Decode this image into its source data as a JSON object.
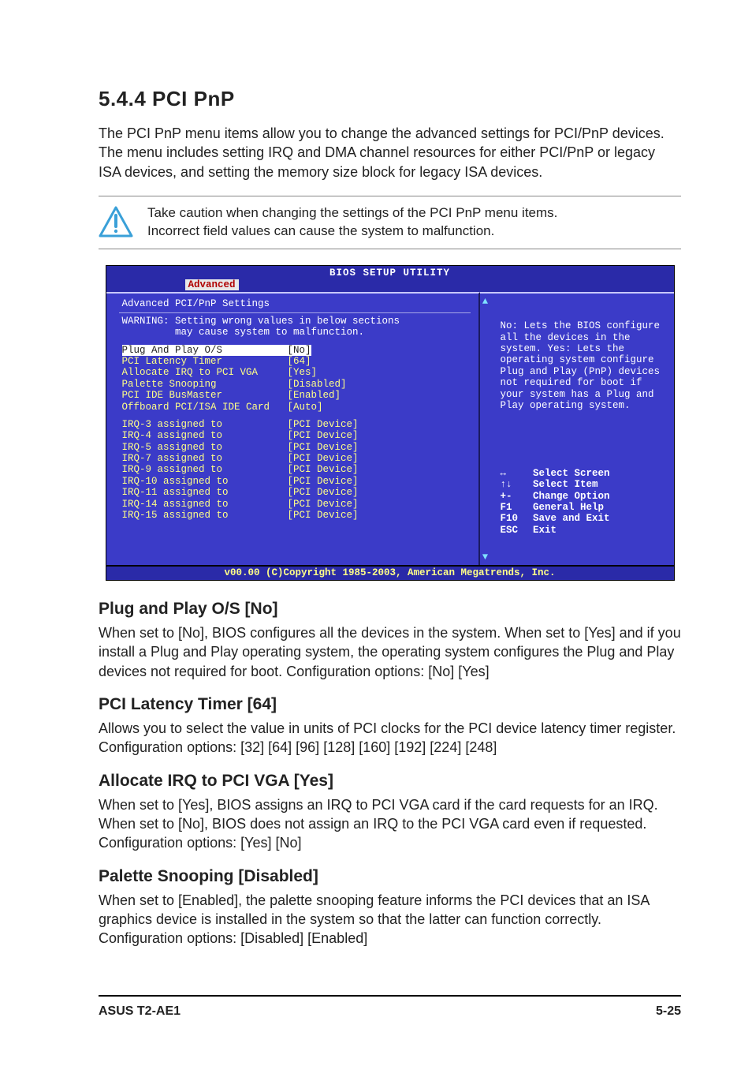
{
  "section": {
    "number_title": "5.4.4   PCI PnP",
    "intro": "The PCI PnP menu items allow you to change the advanced settings for PCI/PnP devices. The menu includes setting IRQ and DMA channel resources for either PCI/PnP or legacy ISA devices, and setting the memory size block for legacy ISA devices."
  },
  "callout": {
    "line1": "Take caution when changing the settings of the PCI PnP menu items.",
    "line2": "Incorrect field values can cause the system to malfunction."
  },
  "bios": {
    "title": "BIOS SETUP UTILITY",
    "tab": "Advanced",
    "left": {
      "heading": "Advanced PCI/PnP Settings",
      "warn1": "WARNING: Setting wrong values in below sections",
      "warn2": "         may cause system to malfunction.",
      "options": [
        {
          "name": "Plug And Play O/S",
          "val": "[No]",
          "sel": true
        },
        {
          "name": "PCI Latency Timer",
          "val": "[64]"
        },
        {
          "name": "Allocate IRQ to PCI VGA",
          "val": "[Yes]"
        },
        {
          "name": "Palette Snooping",
          "val": "[Disabled]"
        },
        {
          "name": "PCI IDE BusMaster",
          "val": "[Enabled]"
        },
        {
          "name": "Offboard PCI/ISA IDE Card",
          "val": "[Auto]"
        }
      ],
      "irqs": [
        {
          "name": "IRQ-3 assigned to",
          "val": "[PCI Device]"
        },
        {
          "name": "IRQ-4 assigned to",
          "val": "[PCI Device]"
        },
        {
          "name": "IRQ-5 assigned to",
          "val": "[PCI Device]"
        },
        {
          "name": "IRQ-7 assigned to",
          "val": "[PCI Device]"
        },
        {
          "name": "IRQ-9 assigned to",
          "val": "[PCI Device]"
        },
        {
          "name": "IRQ-10 assigned to",
          "val": "[PCI Device]"
        },
        {
          "name": "IRQ-11 assigned to",
          "val": "[PCI Device]"
        },
        {
          "name": "IRQ-14 assigned to",
          "val": "[PCI Device]"
        },
        {
          "name": "IRQ-15 assigned to",
          "val": "[PCI Device]"
        }
      ]
    },
    "right": {
      "help": "No: Lets the BIOS configure all the devices in the system. Yes: Lets the operating system configure Plug and Play (PnP) devices not required for boot if your system has a Plug and Play operating system.",
      "keys": [
        {
          "k": "↔",
          "label": "Select Screen"
        },
        {
          "k": "↑↓",
          "label": "Select Item"
        },
        {
          "k": "+-",
          "label": "Change Option"
        },
        {
          "k": "F1",
          "label": "General Help"
        },
        {
          "k": "F10",
          "label": "Save and Exit"
        },
        {
          "k": "ESC",
          "label": "Exit"
        }
      ]
    },
    "footer": "v00.00 (C)Copyright 1985-2003, American Megatrends, Inc."
  },
  "subsections": [
    {
      "title": "Plug and Play O/S [No]",
      "body": "When set to [No], BIOS configures all the devices in the system. When set to [Yes] and if you install a Plug and Play operating system, the operating system configures the Plug and Play devices not required for boot. Configuration options: [No] [Yes]"
    },
    {
      "title": "PCI Latency Timer [64]",
      "body": "Allows you to select the value in units of PCI clocks for the PCI device latency timer register. Configuration options: [32] [64] [96] [128] [160] [192] [224] [248]"
    },
    {
      "title": "Allocate IRQ to PCI VGA [Yes]",
      "body": "When set to [Yes], BIOS assigns an IRQ to PCI VGA card if the card requests for an IRQ. When set to [No], BIOS does not assign an IRQ to the PCI VGA card even if requested. Configuration options: [Yes] [No]"
    },
    {
      "title": "Palette Snooping [Disabled]",
      "body": "When set to [Enabled], the palette snooping feature informs the PCI devices that an ISA graphics device is installed in the system so that the latter can function correctly. Configuration options: [Disabled] [Enabled]"
    }
  ],
  "footer": {
    "left": "ASUS T2-AE1",
    "right": "5-25"
  }
}
